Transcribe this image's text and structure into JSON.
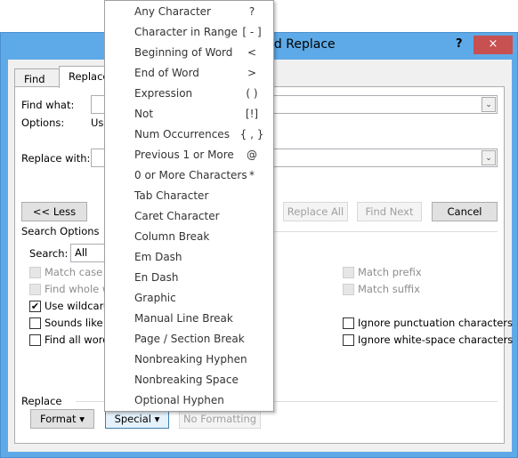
{
  "dialog": {
    "title": "Find and Replace",
    "help": "?",
    "close": "×",
    "tabs": [
      "Find",
      "Replace"
    ],
    "find_what_label": "Find what:",
    "options_label": "Options:",
    "options_value": "Use Wildcards",
    "replace_with_label": "Replace with:",
    "less_button": "<< Less",
    "replace_all_button": "Replace All",
    "find_next_button": "Find Next",
    "cancel_button": "Cancel",
    "search_options_label": "Search Options",
    "search_label": "Search:",
    "search_value": "All",
    "checkboxes_left": [
      {
        "label": "Match case",
        "checked": false,
        "disabled": true
      },
      {
        "label": "Find whole words only",
        "checked": false,
        "disabled": true
      },
      {
        "label": "Use wildcards",
        "checked": true,
        "disabled": false
      },
      {
        "label": "Sounds like (English)",
        "checked": false,
        "disabled": false
      },
      {
        "label": "Find all word forms (English)",
        "checked": false,
        "disabled": false
      }
    ],
    "checkboxes_right": [
      {
        "label": "Match prefix",
        "checked": false,
        "disabled": true
      },
      {
        "label": "Match suffix",
        "checked": false,
        "disabled": true
      },
      {
        "label": "Ignore punctuation characters",
        "checked": false,
        "disabled": false
      },
      {
        "label": "Ignore white-space characters",
        "checked": false,
        "disabled": false
      }
    ],
    "replace_section_label": "Replace",
    "format_button": "Format ▾",
    "special_button": "Special ▾",
    "no_formatting_button": "No Formatting"
  },
  "special_menu": [
    {
      "label": "Any Character",
      "shortcut": "?"
    },
    {
      "label": "Character in Range",
      "shortcut": "[ - ]"
    },
    {
      "label": "Beginning of Word",
      "shortcut": "<"
    },
    {
      "label": "End of Word",
      "shortcut": ">"
    },
    {
      "label": "Expression",
      "shortcut": "( )"
    },
    {
      "label": "Not",
      "shortcut": "[!]"
    },
    {
      "label": "Num Occurrences",
      "shortcut": "{ , }"
    },
    {
      "label": "Previous 1 or More",
      "shortcut": "@"
    },
    {
      "label": "0 or More Characters",
      "shortcut": "*"
    },
    {
      "label": "Tab Character",
      "shortcut": ""
    },
    {
      "label": "Caret Character",
      "shortcut": ""
    },
    {
      "label": "Column Break",
      "shortcut": ""
    },
    {
      "label": "Em Dash",
      "shortcut": ""
    },
    {
      "label": "En Dash",
      "shortcut": ""
    },
    {
      "label": "Graphic",
      "shortcut": ""
    },
    {
      "label": "Manual Line Break",
      "shortcut": ""
    },
    {
      "label": "Page / Section Break",
      "shortcut": ""
    },
    {
      "label": "Nonbreaking Hyphen",
      "shortcut": ""
    },
    {
      "label": "Nonbreaking Space",
      "shortcut": ""
    },
    {
      "label": "Optional Hyphen",
      "shortcut": ""
    }
  ]
}
